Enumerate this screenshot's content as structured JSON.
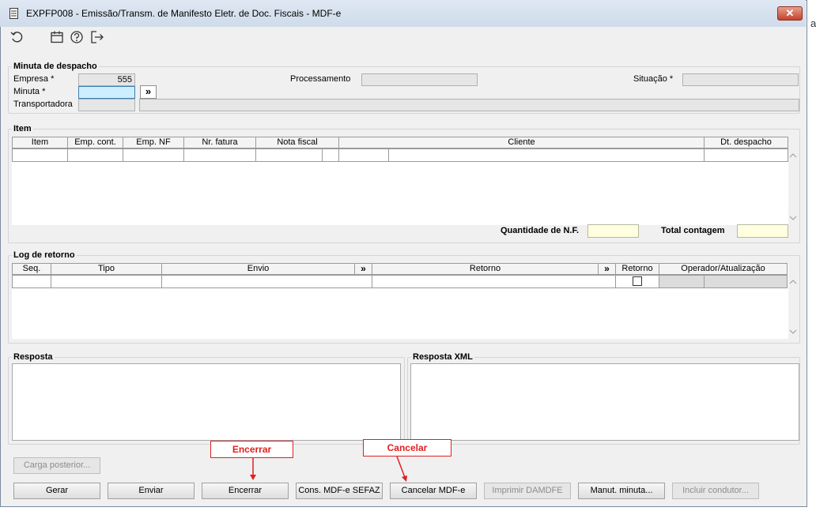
{
  "window": {
    "title": "EXPFP008 - Emissão/Transm. de Manifesto Eletr. de Doc. Fiscais - MDF-e",
    "close_label": "✕",
    "side_text": "a"
  },
  "toolbar": {
    "icons": [
      "undo-icon",
      "calendar-icon",
      "help-icon",
      "exit-icon"
    ]
  },
  "despacho": {
    "legend": "Minuta de despacho",
    "empresa_label": "Empresa *",
    "empresa_value": "555",
    "minuta_label": "Minuta *",
    "minuta_value": "",
    "expand_label": "»",
    "transportadora_label": "Transportadora",
    "processamento_label": "Processamento",
    "situacao_label": "Situação *"
  },
  "item": {
    "legend": "Item",
    "columns": [
      "Item",
      "Emp. cont.",
      "Emp. NF",
      "Nr. fatura",
      "Nota fiscal",
      "Cliente",
      "Dt. despacho"
    ],
    "qtd_nf_label": "Quantidade de N.F.",
    "total_label": "Total contagem"
  },
  "log": {
    "legend": "Log de retorno",
    "columns": [
      "Seq.",
      "Tipo",
      "Envio",
      "»",
      "Retorno",
      "»",
      "Retorno",
      "Operador/Atualização"
    ]
  },
  "resposta": {
    "legend": "Resposta"
  },
  "resposta_xml": {
    "legend": "Resposta XML"
  },
  "buttons": {
    "carga_posterior": "Carga posterior...",
    "gerar": "Gerar",
    "enviar": "Enviar",
    "encerrar": "Encerrar",
    "cons_mdfe": "Cons. MDF-e SEFAZ",
    "cancelar_mdfe": "Cancelar MDF-e",
    "imprimir": "Imprimir DAMDFE",
    "manut_minuta": "Manut. minuta...",
    "incluir_condutor": "Incluir condutor..."
  },
  "annotations": {
    "encerrar": "Encerrar",
    "cancelar": "Cancelar",
    "color": "#e02020"
  }
}
